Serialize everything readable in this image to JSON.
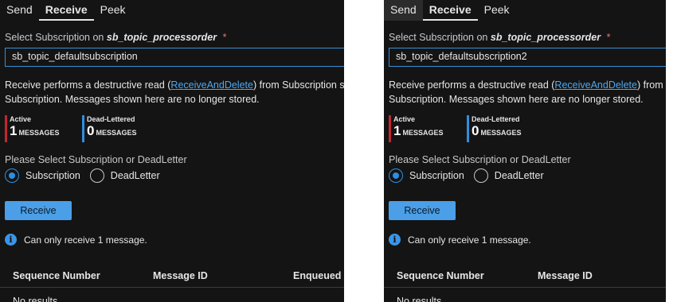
{
  "left": {
    "tabs": [
      {
        "label": "Send"
      },
      {
        "label": "Receive"
      },
      {
        "label": "Peek"
      }
    ],
    "subscription_label_prefix": "Select Subscription on",
    "topic": "sb_topic_processorder",
    "required_mark": "*",
    "subscription_value": "sb_topic_defaultsubscription",
    "desc_prefix": "Receive performs a destructive read (",
    "desc_link": "ReceiveAndDelete",
    "desc_suffix": ") from Subscription sb",
    "desc_line2": "Subscription. Messages shown here are no longer stored.",
    "active": {
      "title": "Active",
      "count": "1",
      "unit": "MESSAGES"
    },
    "deadletter": {
      "title": "Dead-Lettered",
      "count": "0",
      "unit": "MESSAGES"
    },
    "select_label": "Please Select Subscription or DeadLetter",
    "radio_subscription": "Subscription",
    "radio_deadletter": "DeadLetter",
    "receive_button": "Receive",
    "info_text": "Can only receive 1 message.",
    "columns": [
      "Sequence Number",
      "Message ID",
      "Enqueued T"
    ],
    "no_results": "No results"
  },
  "right": {
    "tabs": [
      {
        "label": "Send"
      },
      {
        "label": "Receive"
      },
      {
        "label": "Peek"
      }
    ],
    "subscription_label_prefix": "Select Subscription on",
    "topic": "sb_topic_processorder",
    "required_mark": "*",
    "subscription_value": "sb_topic_defaultsubscription2",
    "desc_prefix": "Receive performs a destructive read (",
    "desc_link": "ReceiveAndDelete",
    "desc_suffix": ") from S",
    "desc_line2": "Subscription. Messages shown here are no longer stored.",
    "active": {
      "title": "Active",
      "count": "1",
      "unit": "MESSAGES"
    },
    "deadletter": {
      "title": "Dead-Lettered",
      "count": "0",
      "unit": "MESSAGES"
    },
    "select_label": "Please Select Subscription or DeadLetter",
    "radio_subscription": "Subscription",
    "radio_deadletter": "DeadLetter",
    "receive_button": "Receive",
    "info_text": "Can only receive 1 message.",
    "columns": [
      "Sequence Number",
      "Message ID"
    ],
    "no_results": "No results"
  },
  "colors": {
    "active_bar": "#c4262e",
    "deadletter_bar": "#2f8ee0",
    "accent": "#4a9fe8"
  }
}
